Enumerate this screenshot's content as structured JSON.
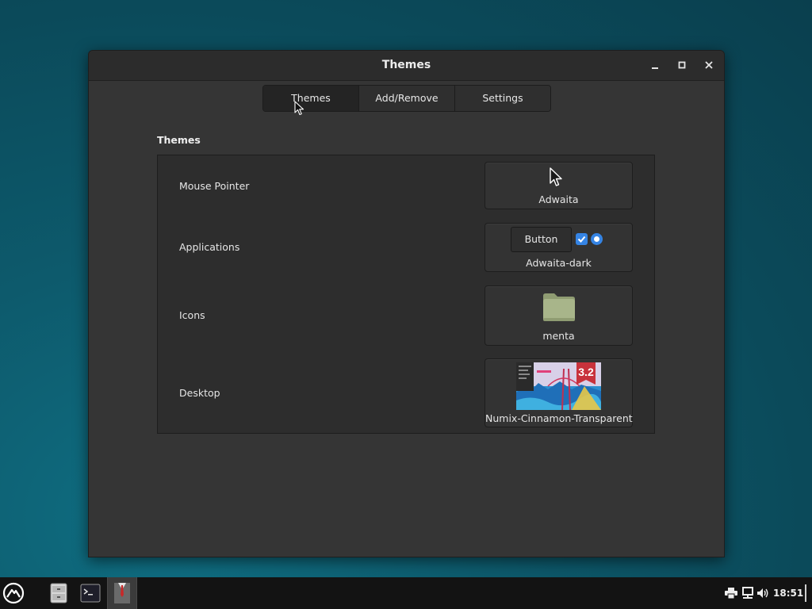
{
  "window": {
    "title": "Themes"
  },
  "tabs": [
    {
      "label": "Themes",
      "active": true
    },
    {
      "label": "Add/Remove",
      "active": false
    },
    {
      "label": "Settings",
      "active": false
    }
  ],
  "section": {
    "title": "Themes"
  },
  "rows": {
    "mouse_pointer": {
      "label": "Mouse Pointer",
      "value": "Adwaita"
    },
    "applications": {
      "label": "Applications",
      "value": "Adwaita-dark",
      "preview_button_label": "Button"
    },
    "icons": {
      "label": "Icons",
      "value": "menta"
    },
    "desktop": {
      "label": "Desktop",
      "value": "Numix-Cinnamon-Transparent",
      "preview_badge": "3.2"
    }
  },
  "taskbar": {
    "items": [
      "menu-icon",
      "file-manager-icon",
      "terminal-icon",
      "themes-app-icon"
    ],
    "tray": [
      "printer-icon",
      "network-icon",
      "volume-icon"
    ],
    "clock": "18:51"
  },
  "colors": {
    "accent": "#3584e4",
    "window_bg": "#353535",
    "titlebar_bg": "#2c2c2c",
    "folder": "#a8b58a"
  }
}
